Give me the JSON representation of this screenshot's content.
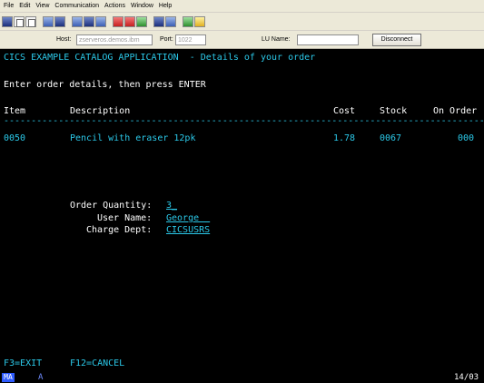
{
  "menubar": {
    "items": [
      "File",
      "Edit",
      "View",
      "Communication",
      "Actions",
      "Window",
      "Help"
    ]
  },
  "connection": {
    "host_label": "Host:",
    "host_value": "zserveros.demos.ibm",
    "port_label": "Port:",
    "port_value": "1022",
    "lu_label": "LU Name:",
    "lu_value": "",
    "disconnect_label": "Disconnect"
  },
  "terminal": {
    "title": "CICS EXAMPLE CATALOG APPLICATION  - Details of your order",
    "instruction": "Enter order details, then press ENTER",
    "columns": {
      "item": "Item",
      "description": "Description",
      "cost": "Cost",
      "stock": "Stock",
      "on_order": "On Order"
    },
    "separator": "------------------------------------------------------------------------------------------",
    "order": {
      "item": "0050",
      "description": "Pencil with eraser 12pk",
      "cost": "1.78",
      "stock": "0067",
      "on_order": "000"
    },
    "form": {
      "quantity_label": "Order Quantity:",
      "quantity_value": "3_",
      "user_label": "User Name:",
      "user_value": "George  ",
      "dept_label": "Charge Dept:",
      "dept_value": "CICSUSRS"
    },
    "function_keys": {
      "f3": "F3=EXIT",
      "f12": "F12=CANCEL"
    }
  },
  "status": {
    "mode": "MA",
    "indicator": "A",
    "cursor_pos": "14/03"
  },
  "colors": {
    "terminal_bg": "#000000",
    "green": "#21c521",
    "white": "#ffffff",
    "turquoise": "#2bc8e8"
  }
}
